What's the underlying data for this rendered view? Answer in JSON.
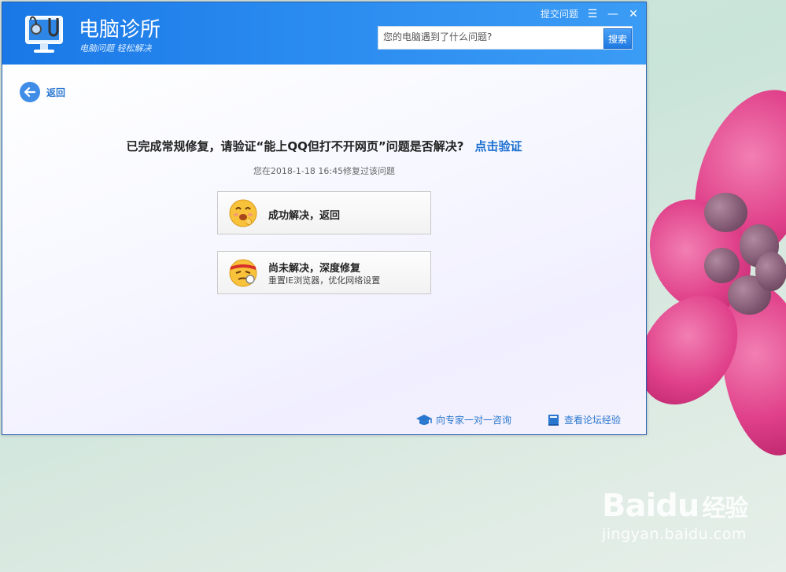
{
  "app": {
    "title": "电脑诊所",
    "slogan": "电脑问题 轻松解决"
  },
  "window_controls": {
    "submit_question": "提交问题",
    "menu_symbol": "☰",
    "minimize_symbol": "—",
    "close_symbol": "✕"
  },
  "search": {
    "placeholder": "您的电脑遇到了什么问题?",
    "button_label": "搜索"
  },
  "back": {
    "label": "返回"
  },
  "main": {
    "headline": "已完成常规修复，请验证“能上QQ但打不开网页”问题是否解决?",
    "verify_link": "点击验证",
    "repair_note": "您在2018-1-18 16:45修复过该问题"
  },
  "options": [
    {
      "title": "成功解决，返回",
      "subtitle": ""
    },
    {
      "title": "尚未解决，深度修复",
      "subtitle": "重置IE浏览器，优化网络设置"
    }
  ],
  "footer": {
    "expert_link": "向专家一对一咨询",
    "forum_link": "查看论坛经验"
  },
  "watermark": {
    "logo": "Baidu",
    "logo_cn": "经验",
    "url": "jingyan.baidu.com"
  },
  "colors": {
    "titlebar": "#2b8cf0",
    "link": "#1b6fd0",
    "flower": "#e0418a"
  }
}
